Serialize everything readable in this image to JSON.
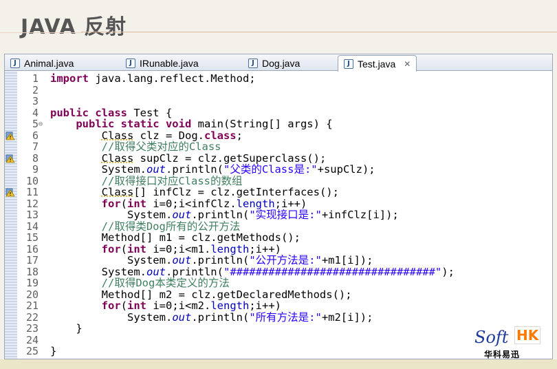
{
  "slide": {
    "title": "JAVA 反射"
  },
  "tabs": [
    {
      "label": "Animal.java",
      "icon": "java-file-icon",
      "active": false
    },
    {
      "label": "IRunable.java",
      "icon": "java-file-icon",
      "active": false
    },
    {
      "label": "Dog.java",
      "icon": "java-file-icon",
      "active": false
    },
    {
      "label": "Test.java",
      "icon": "java-file-icon",
      "active": true,
      "close": "✕"
    }
  ],
  "code_lines": [
    {
      "n": "1",
      "fold": "",
      "html": "<span class=\"kw\">import</span> java.lang.reflect.Method;"
    },
    {
      "n": "2",
      "fold": "",
      "html": ""
    },
    {
      "n": "3",
      "fold": "",
      "html": ""
    },
    {
      "n": "4",
      "fold": "",
      "html": "<span class=\"kw\">public class</span> Test {"
    },
    {
      "n": "5",
      "fold": "⊖",
      "html": "    <span class=\"kw\">public static void</span> main(String[] args) {"
    },
    {
      "n": "6",
      "fold": "",
      "html": "        <span class=\"ul\">Class</span> clz = Dog.<span class=\"kw\">class</span>;",
      "marker": true
    },
    {
      "n": "7",
      "fold": "",
      "html": "        <span class=\"cm\">//取得父类对应的Class</span>"
    },
    {
      "n": "8",
      "fold": "",
      "html": "        <span class=\"ul\">Class</span> supClz = clz.getSuperclass();",
      "marker": true
    },
    {
      "n": "9",
      "fold": "",
      "html": "        System.<span class=\"fi\">out</span>.println(<span class=\"st\">\"父类的Class是:\"</span>+supClz);"
    },
    {
      "n": "10",
      "fold": "",
      "html": "        <span class=\"cm\">//取得接口对应Class的数组</span>"
    },
    {
      "n": "11",
      "fold": "",
      "html": "        <span class=\"ul\">Class</span>[] infClz = clz.getInterfaces();",
      "marker": true
    },
    {
      "n": "12",
      "fold": "",
      "html": "        <span class=\"kw\">for</span>(<span class=\"kw\">int</span> i=0;i&lt;infClz.<span class=\"fl\">length</span>;i++)"
    },
    {
      "n": "13",
      "fold": "",
      "html": "            System.<span class=\"fi\">out</span>.println(<span class=\"st\">\"实现接口是:\"</span>+infClz[i]);"
    },
    {
      "n": "14",
      "fold": "",
      "html": "        <span class=\"cm\">//取得类Dog所有的公开方法</span>"
    },
    {
      "n": "15",
      "fold": "",
      "html": "        Method[] m1 = clz.getMethods();"
    },
    {
      "n": "16",
      "fold": "",
      "html": "        <span class=\"kw\">for</span>(<span class=\"kw\">int</span> i=0;i&lt;m1.<span class=\"fl\">length</span>;i++)"
    },
    {
      "n": "17",
      "fold": "",
      "html": "            System.<span class=\"fi\">out</span>.println(<span class=\"st\">\"公开方法是:\"</span>+m1[i]);"
    },
    {
      "n": "18",
      "fold": "",
      "html": "        System.<span class=\"fi\">out</span>.println(<span class=\"st\">\"################################\"</span>);"
    },
    {
      "n": "19",
      "fold": "",
      "html": "        <span class=\"cm\">//取得Dog本类定义的方法</span>"
    },
    {
      "n": "20",
      "fold": "",
      "html": "        Method[] m2 = clz.getDeclaredMethods();"
    },
    {
      "n": "21",
      "fold": "",
      "html": "        <span class=\"kw\">for</span>(<span class=\"kw\">int</span> i=0;i&lt;m2.<span class=\"fl\">length</span>;i++)"
    },
    {
      "n": "22",
      "fold": "",
      "html": "            System.<span class=\"fi\">out</span>.println(<span class=\"st\">\"所有方法是:\"</span>+m2[i]);"
    },
    {
      "n": "23",
      "fold": "",
      "html": "    }"
    },
    {
      "n": "24",
      "fold": "",
      "html": ""
    },
    {
      "n": "25",
      "fold": "",
      "html": "}"
    }
  ],
  "logo": {
    "soft": "Soft",
    "hk": "HK",
    "cn": "华科易迅"
  },
  "colors": {
    "keyword": "#7f0055",
    "comment": "#3f7f5f",
    "string": "#2a00ff",
    "field": "#0000c0",
    "title": "#555555",
    "logo_blue": "#1e3a9a",
    "logo_orange": "#ff7a00"
  },
  "icons": {
    "marker": "warning-marker-icon"
  }
}
